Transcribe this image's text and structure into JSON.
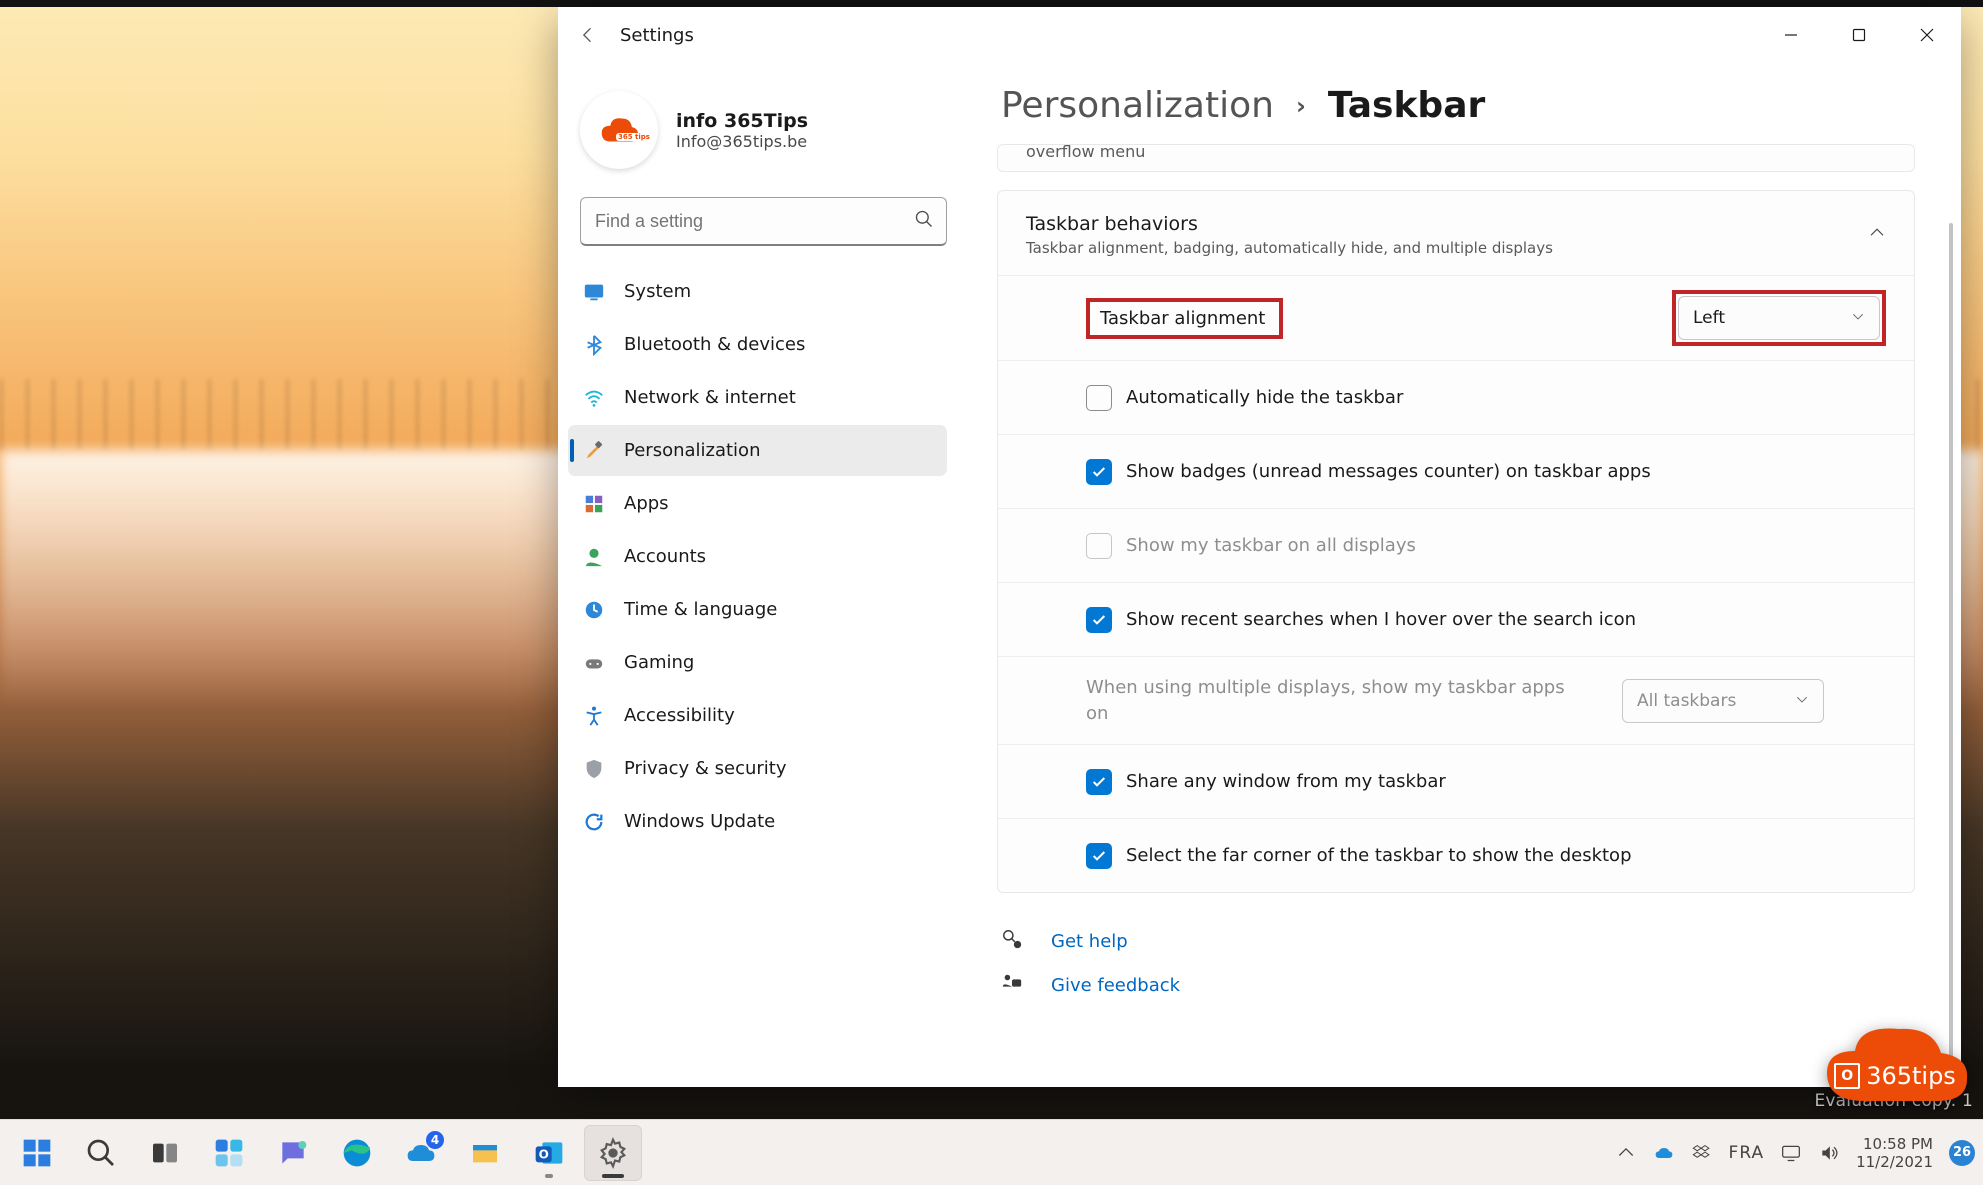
{
  "app": {
    "title": "Settings",
    "user": {
      "name": "info 365Tips",
      "email": "Info@365tips.be",
      "avatar_badge": "365 tips"
    }
  },
  "search": {
    "placeholder": "Find a setting"
  },
  "sidebar": {
    "items": [
      {
        "key": "system",
        "label": "System"
      },
      {
        "key": "bluetooth",
        "label": "Bluetooth & devices"
      },
      {
        "key": "network",
        "label": "Network & internet"
      },
      {
        "key": "personalization",
        "label": "Personalization"
      },
      {
        "key": "apps",
        "label": "Apps"
      },
      {
        "key": "accounts",
        "label": "Accounts"
      },
      {
        "key": "time",
        "label": "Time & language"
      },
      {
        "key": "gaming",
        "label": "Gaming"
      },
      {
        "key": "accessibility",
        "label": "Accessibility"
      },
      {
        "key": "privacy",
        "label": "Privacy & security"
      },
      {
        "key": "update",
        "label": "Windows Update"
      }
    ],
    "active": "personalization"
  },
  "breadcrumb": {
    "parent": "Personalization",
    "current": "Taskbar"
  },
  "stub_card": {
    "text": "overflow menu"
  },
  "behaviors": {
    "title": "Taskbar behaviors",
    "subtitle": "Taskbar alignment, badging, automatically hide, and multiple displays",
    "alignment": {
      "label": "Taskbar alignment",
      "value": "Left"
    },
    "auto_hide": {
      "label": "Automatically hide the taskbar",
      "checked": false,
      "enabled": true
    },
    "badges": {
      "label": "Show badges (unread messages counter) on taskbar apps",
      "checked": true,
      "enabled": true
    },
    "all_displays": {
      "label": "Show my taskbar on all displays",
      "checked": false,
      "enabled": false
    },
    "recent": {
      "label": "Show recent searches when I hover over the search icon",
      "checked": true,
      "enabled": true
    },
    "multi": {
      "label": "When using multiple displays, show my taskbar apps on",
      "value": "All taskbars",
      "enabled": false
    },
    "share": {
      "label": "Share any window from my taskbar",
      "checked": true,
      "enabled": true
    },
    "corner": {
      "label": "Select the far corner of the taskbar to show the desktop",
      "checked": true,
      "enabled": true
    }
  },
  "links": {
    "help": "Get help",
    "feedback": "Give feedback"
  },
  "taskbar": {
    "apps": [
      {
        "key": "start",
        "name": "Start"
      },
      {
        "key": "search",
        "name": "Search"
      },
      {
        "key": "taskview",
        "name": "Task view"
      },
      {
        "key": "widgets",
        "name": "Widgets"
      },
      {
        "key": "chat",
        "name": "Chat"
      },
      {
        "key": "edge",
        "name": "Microsoft Edge"
      },
      {
        "key": "onedrive",
        "name": "OneDrive",
        "badge": "4"
      },
      {
        "key": "explorer",
        "name": "File Explorer"
      },
      {
        "key": "outlook",
        "name": "Outlook",
        "running": true
      },
      {
        "key": "settings",
        "name": "Settings",
        "running": true,
        "active": true
      }
    ],
    "tray": {
      "chevron": "Show hidden icons",
      "cloud": "OneDrive",
      "dropbox": "Dropbox",
      "lang": "FRA",
      "display": "Display",
      "sound": "Volume",
      "time": "10:58 PM",
      "date": "11/2/2021",
      "notif": "26"
    }
  },
  "evaluation_watermark": "Evaluation copy.                                      1",
  "watermark": {
    "text": "365tips"
  }
}
